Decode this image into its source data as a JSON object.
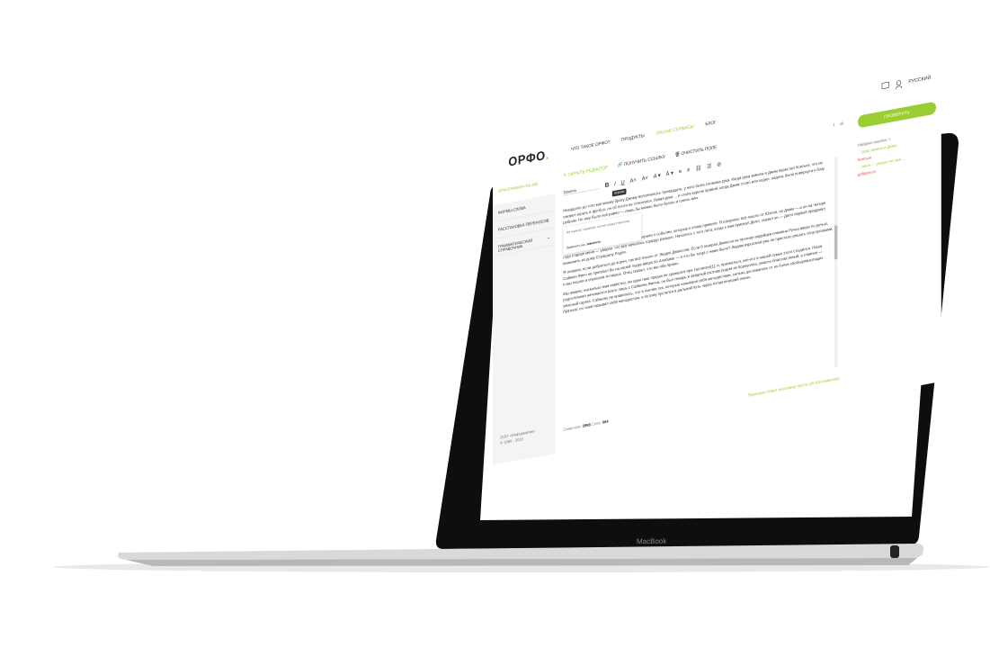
{
  "device": {
    "brand_label": "MacBook"
  },
  "header": {
    "logo_text": "ОРФО",
    "nav": [
      {
        "label": "ЧТО ТАКОЕ ОРФО?"
      },
      {
        "label": "ПРОДУКТЫ"
      },
      {
        "label": "ONLINE СЕРВИСЫ"
      },
      {
        "label": "БЛОГ"
      }
    ],
    "language": "РУССКИЙ"
  },
  "sidebar": {
    "active": "ОРФОГРАФИЯ ONLINE",
    "items": [
      {
        "label": "ФОРМЫ СЛОВА"
      },
      {
        "label": "РАССТАНОВКА ПЕРЕНОСОВ"
      },
      {
        "label": "ГРАММАТИЧЕСКИЙ СПРАВОЧНИК"
      }
    ],
    "copyright_1": "ООО «Информатик»",
    "copyright_2": "© 1989 - 2019"
  },
  "editor": {
    "toolbar_actions": [
      {
        "label": "СКРЫТЬ РЕДАКТОР"
      },
      {
        "label": "ПОЛУЧИТЬ ССЫЛКУ"
      },
      {
        "label": "ОЧИСТИТЬ ПОЛЕ"
      }
    ],
    "social": [
      "f",
      "vk"
    ],
    "font": "Tahoma",
    "tooltip": "Курсив",
    "popup_placeholder": "Не нажмат значение после слова (тексола)",
    "popup_label": "Заменить на:",
    "popup_value": "заменить",
    "paragraphs": [
      "Незадолго до того как моему брату Джиму исполнилось тринадцать, у него была сломана рука. Когда рука зажила и Джим перестал бояться, что не сможет играть в футбол, он об почти не стеснялся. Левая рука ... и стала короче правой; когда Джим стоял или ходил, ладонь была повернута к боку ребром. Но ему было всё равно — лишь бы можно было бегать и гонять мяч.",
      "Когда с тех пор прошли годы, мы иной раз спорили о событии, которые к этому привели. Я говорила: всё пошло от Юэлов, но Джим — а он на четыре года старше меня — уверял, что всё началось гораздо раньше. Началось с того лета, когда к нам приехал Дилл, сказал он — Дилл первый придумал выманить из дому Страшилу Рэдли.",
      "Я сказала, если добраться до корня, так всё пошло от Эндрю Джексона. Если б генерал Джексон не прогнал индейцев племени Ручьи вверх по ручью, Саймон Финч не приплыл бы на своей лодке вверх по Алабаме — и что бы тогда с нами было? Людям взрослым уже не пристало решать спор кулаками, и мы пошли и спросили Аттикуса. Отец сказал, что мы оба правы.",
      "Мы южане; насколько нам известно, ни один наш предок не сражался при Гастингсе[1], и, признаться, кое-кто в нашей семье этого стыдился. Наша родословная начинается всего лишь с Саймона Финча, он был лекарь и заядлый охотник родом из Корнуолла, ужасно благочестивый, а главное — ужасный скряга. Саймону не нравилось, что в Англии тех, которые называли себя методистами, сильно доставалось от их более свободомыслящих братьев; он тоже называл себя методистом, а потому пустился в дальний путь через Атлантический океан."
    ],
    "status_chars_label": "Символов:",
    "status_chars": "3998",
    "status_words_label": "Слов:",
    "status_words": "964",
    "warning": "Превышен лимит на размер текста (20 000 символов)"
  },
  "right_panel": {
    "check_button": "ПРОВЕРИТЬ",
    "found_label": "Найдено ошибок:",
    "found_count": "4",
    "errors": [
      {
        "text": "... рука зажила и Джим ...",
        "color": "green"
      },
      {
        "text": "бояться",
        "color": "red"
      },
      {
        "text": "... меня — уверял что всё ...",
        "color": "green"
      },
      {
        "text": "добраться",
        "color": "red"
      }
    ]
  },
  "colors": {
    "accent": "#9acd32",
    "error": "#e04a3f",
    "bezel": "#111111"
  }
}
